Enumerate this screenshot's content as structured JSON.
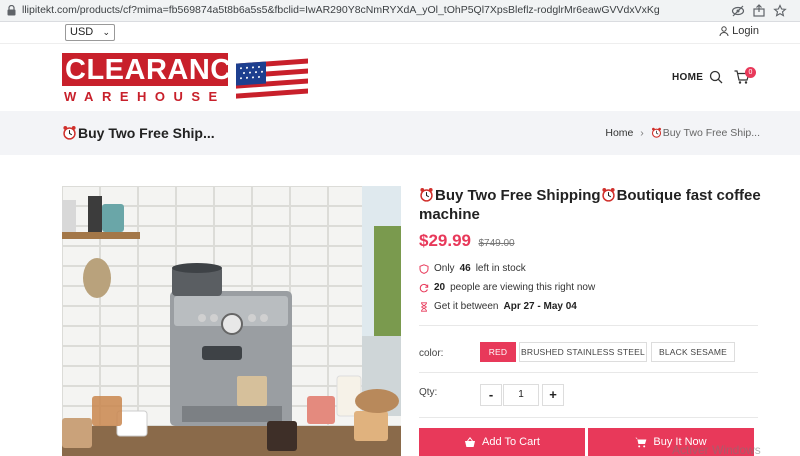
{
  "browser": {
    "url": "llipitekt.com/products/cf?mima=fb569874a5t8b6a5s5&fbclid=IwAR290Y8cNmRYXdA_yOl_tOhP5Ql7XpsBleflz-rodglrMr6eawGVVdxVxKg"
  },
  "topbar": {
    "currency": "USD",
    "login_label": "Login"
  },
  "header": {
    "logo_top": "CLEARANCE",
    "logo_bottom": "WAREHOUSE",
    "nav_home": "HOME",
    "cart_count": "0"
  },
  "breadcrumb": {
    "page_title": "Buy Two Free Ship...",
    "home": "Home",
    "current": "Buy Two Free Ship..."
  },
  "product": {
    "title_part1": "Buy Two Free Shipping",
    "title_part2": "Boutique fast coffee machine",
    "price": "$29.99",
    "old_price": "$749.00",
    "stock_prefix": "Only",
    "stock_count": "46",
    "stock_suffix": "left in stock",
    "viewers_count": "20",
    "viewers_suffix": "people are viewing this right now",
    "delivery_prefix": "Get it between",
    "delivery_range": "Apr 27 - May 04",
    "color_label": "color:",
    "color_options": [
      "RED",
      "BRUSHED STAINLESS STEEL",
      "BLACK SESAME"
    ],
    "qty_label": "Qty:",
    "qty_minus": "-",
    "qty_value": "1",
    "qty_plus": "+",
    "add_to_cart": "Add To Cart",
    "buy_now": "Buy It Now"
  },
  "colors": {
    "accent": "#e8395a",
    "logo_red": "#c8202b",
    "band_bg": "#f3f4f7"
  },
  "overlay": {
    "watermark": "Activer Windows"
  }
}
